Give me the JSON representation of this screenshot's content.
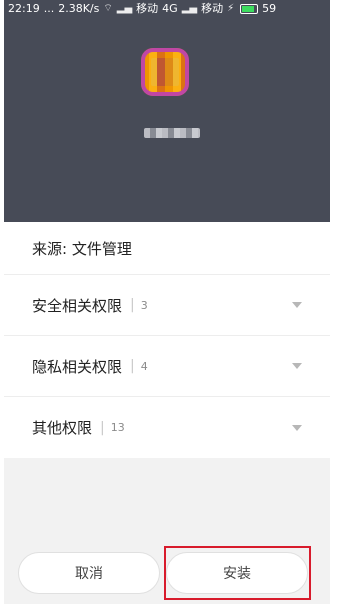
{
  "status_bar": {
    "time": "22:19",
    "dots": "...",
    "speed": "2.38K/s",
    "carrier1": "移动",
    "network": "4G",
    "carrier2": "移动",
    "battery": "59"
  },
  "app": {
    "icon": "app-icon",
    "name_blurred": true
  },
  "source": {
    "label": "来源: 文件管理"
  },
  "permissions": [
    {
      "label": "安全相关权限",
      "count": "3"
    },
    {
      "label": "隐私相关权限",
      "count": "4"
    },
    {
      "label": "其他权限",
      "count": "13"
    }
  ],
  "buttons": {
    "cancel": "取消",
    "install": "安装"
  },
  "colors": {
    "header_bg": "#474b57",
    "highlight_border": "#d81b2c"
  }
}
